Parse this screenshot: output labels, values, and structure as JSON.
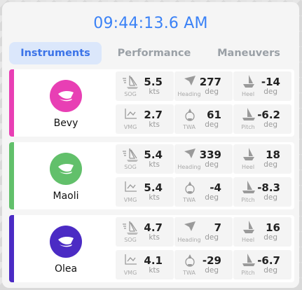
{
  "clock": "09:44:13.6 AM",
  "tabs": [
    "Instruments",
    "Performance",
    "Maneuvers"
  ],
  "labels": {
    "sog": "SOG",
    "heading": "Heading",
    "heel": "Heel",
    "vmg": "VMG",
    "twa": "TWA",
    "pitch": "Pitch"
  },
  "units": {
    "speed": "kts",
    "angle": "deg"
  },
  "boats": [
    {
      "name": "Bevy",
      "color": "#e83fb4",
      "sog": "5.5",
      "heading": "277",
      "heel": "-14",
      "vmg": "2.7",
      "twa": "61",
      "pitch": "-6.2"
    },
    {
      "name": "Maoli",
      "color": "#62c06b",
      "sog": "5.4",
      "heading": "339",
      "heel": "18",
      "vmg": "5.4",
      "twa": "-4",
      "pitch": "-8.3"
    },
    {
      "name": "Olea",
      "color": "#4b2bc4",
      "sog": "4.7",
      "heading": "7",
      "heel": "16",
      "vmg": "4.1",
      "twa": "-29",
      "pitch": "-6.7"
    }
  ],
  "icons": {
    "sog": "sailboat-speed-icon",
    "heading": "heading-arrow-icon",
    "heel": "heel-icon",
    "vmg": "vmg-chart-icon",
    "twa": "wind-angle-icon",
    "pitch": "pitch-icon",
    "boat": "boat-hull-icon"
  }
}
